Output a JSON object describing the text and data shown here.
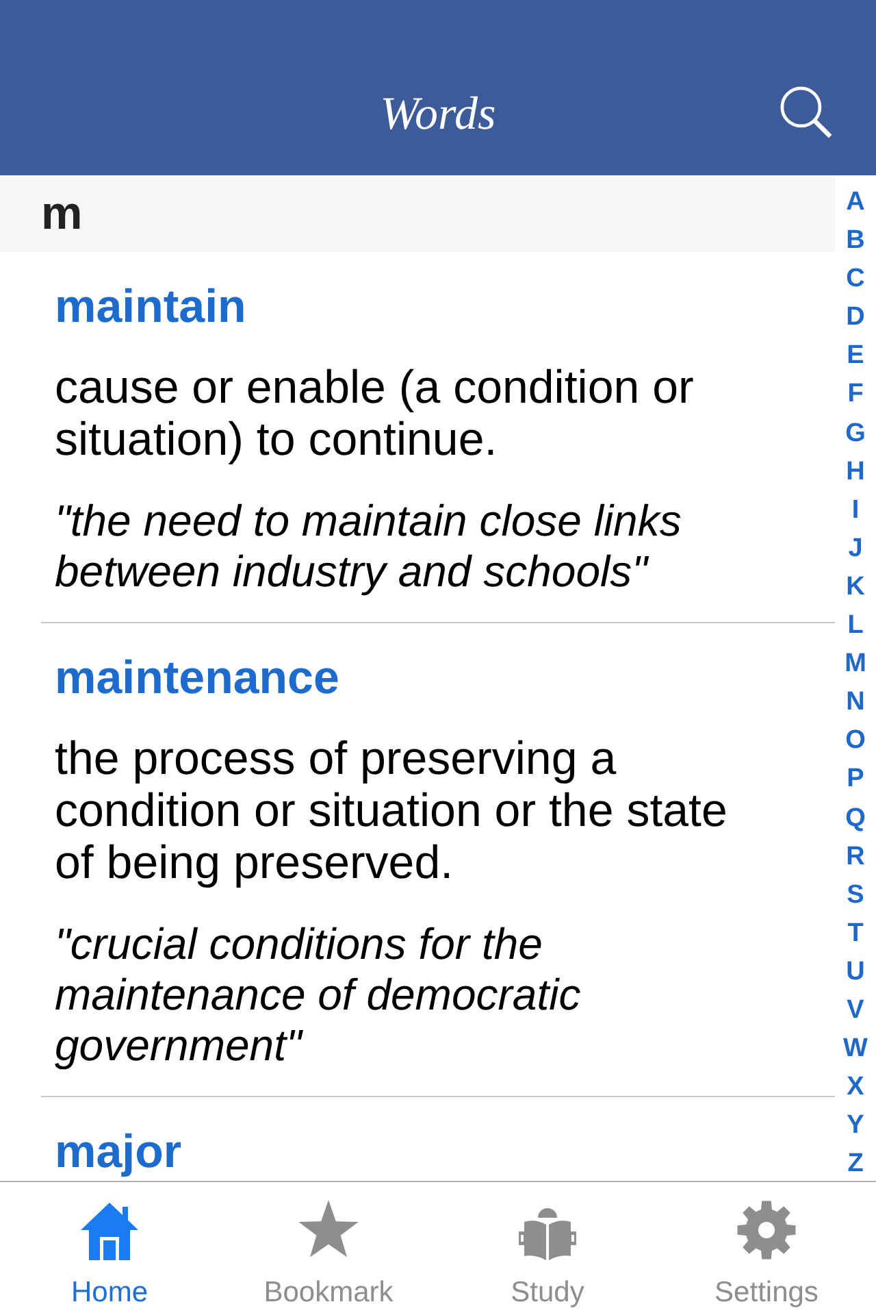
{
  "nav_bar": {
    "title": "Words"
  },
  "section_header": "m",
  "entries": [
    {
      "word": "maintain",
      "definition": "cause or enable (a condition or situation) to continue.",
      "example": "\"the need to maintain close links between industry and schools\""
    },
    {
      "word": "maintenance",
      "definition": "the process of preserving a condition or situation or the state of being preserved.",
      "example": "\"crucial conditions for the maintenance of democratic government\""
    },
    {
      "word": "major"
    }
  ],
  "section_index": [
    "A",
    "B",
    "C",
    "D",
    "E",
    "F",
    "G",
    "H",
    "I",
    "J",
    "K",
    "L",
    "M",
    "N",
    "O",
    "P",
    "Q",
    "R",
    "S",
    "T",
    "U",
    "V",
    "W",
    "X",
    "Y",
    "Z"
  ],
  "tabs": [
    {
      "label": "Home",
      "selected": true
    },
    {
      "label": "Bookmark",
      "selected": false
    },
    {
      "label": "Study",
      "selected": false
    },
    {
      "label": "Settings",
      "selected": false
    }
  ]
}
